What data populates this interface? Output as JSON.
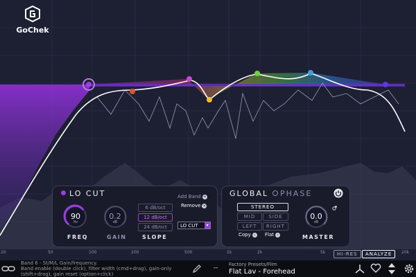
{
  "app": {
    "name": "GoChek"
  },
  "eq": {
    "freq_ticks": [
      "20",
      "50",
      "100",
      "200",
      "500",
      "1k",
      "2k",
      "5k",
      "20k"
    ],
    "hi_res_label": "HI-RES",
    "analyze_label": "ANALYZE",
    "band_colors": [
      "#9a3fe0",
      "#e0522f",
      "#c04bd6",
      "#f0c030",
      "#6ed23a",
      "#3fa0e8",
      "#5a3ae0"
    ]
  },
  "band_panel": {
    "title": "LO CUT",
    "freq_value": "90",
    "freq_unit": "Hz",
    "freq_label": "FREQ",
    "gain_value": "0.2",
    "gain_unit": "dB",
    "gain_label": "GAIN",
    "slope_label": "SLOPE",
    "slope_options": [
      "6 dB/oct",
      "12 dB/oct",
      "24 dB/oct"
    ],
    "add_band": "Add Band",
    "remove": "Remove",
    "type_value": "LO CUT"
  },
  "global_panel": {
    "title": "GLOBAL",
    "phase_label": "PHASE",
    "stereo": "STEREO",
    "mid": "MID",
    "side": "SIDE",
    "left": "LEFT",
    "right": "RIGHT",
    "copy": "Copy",
    "flat": "Flat",
    "master_value": "0.0",
    "master_unit": "dB",
    "master_label": "MASTER"
  },
  "footer": {
    "hint_line1": "Band 6 - St/M/L Gain/frequency.",
    "hint_line2": "Band enable (double click), filter width (cmd+drag), gain-only",
    "hint_line3": "(shift+drag), gain reset (option+click)",
    "preset_dashes": "--",
    "preset_category": "Factory Presets/Film",
    "preset_name": "Flat Lav - Forehead"
  }
}
